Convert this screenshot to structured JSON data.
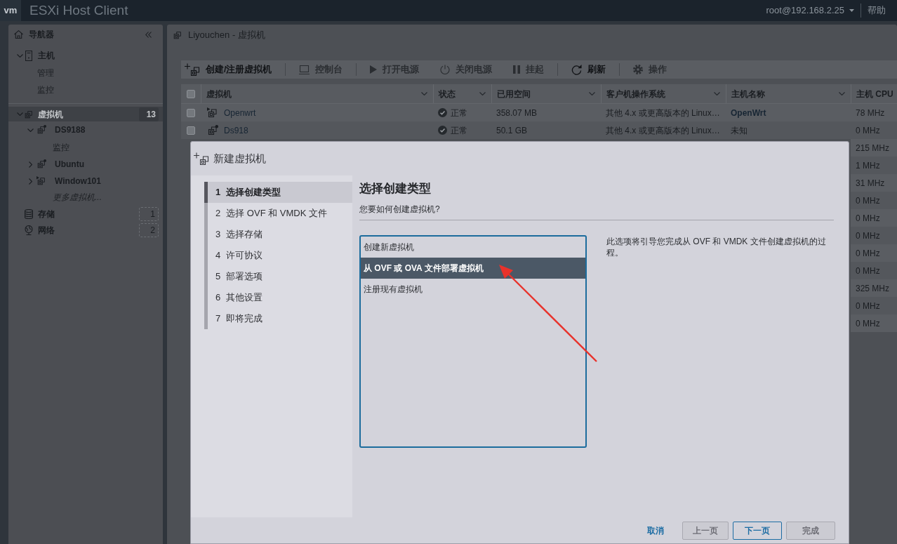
{
  "header": {
    "logo": "vm",
    "title": "ESXi Host Client",
    "user": "root@192.168.2.25",
    "help": "帮助"
  },
  "navigator": {
    "title": "导航器",
    "items": [
      {
        "kind": "host",
        "label": "主机",
        "expanded": true,
        "selected": false,
        "children": [
          {
            "label": "管理",
            "selected": false
          },
          {
            "label": "监控",
            "selected": false
          }
        ]
      },
      {
        "kind": "vms",
        "label": "虚拟机",
        "expanded": true,
        "selected": true,
        "count": "13",
        "children": [
          {
            "kind": "vm",
            "label": "DS9188",
            "running": false,
            "expanded": true,
            "selected": false,
            "children": [
              {
                "label": "监控",
                "selected": false
              }
            ]
          },
          {
            "kind": "vm",
            "label": "Ubuntu",
            "running": false,
            "expanded": false,
            "selected": false
          },
          {
            "kind": "vm",
            "label": "Window101",
            "running": true,
            "expanded": false,
            "selected": false
          },
          {
            "kind": "more",
            "label": "更多虚拟机...",
            "selected": false
          }
        ]
      },
      {
        "kind": "storage",
        "label": "存储",
        "selected": false,
        "count": "1"
      },
      {
        "kind": "network",
        "label": "网络",
        "selected": false,
        "count": "2"
      }
    ]
  },
  "main": {
    "title": "Liyouchen - 虚拟机",
    "toolbar": [
      {
        "items": [
          {
            "kind": "create",
            "label": "创建/注册虚拟机",
            "disabled": false
          }
        ]
      },
      {
        "items": [
          {
            "kind": "console",
            "label": "控制台",
            "disabled": true
          }
        ]
      },
      {
        "items": [
          {
            "kind": "power-on",
            "label": "打开电源",
            "disabled": true
          },
          {
            "kind": "power-off",
            "label": "关闭电源",
            "disabled": true
          },
          {
            "kind": "suspend",
            "label": "挂起",
            "disabled": true
          }
        ]
      },
      {
        "items": [
          {
            "kind": "refresh",
            "label": "刷新",
            "disabled": false
          }
        ]
      },
      {
        "items": [
          {
            "kind": "actions",
            "label": "操作",
            "disabled": true
          }
        ]
      }
    ],
    "table": {
      "select_all_checked": false,
      "columns": [
        "虚拟机",
        "状态",
        "已用空间",
        "客户机操作系统",
        "主机名称",
        "主机 CPU"
      ],
      "rows": [
        {
          "checked": false,
          "vm": "Openwrt",
          "running": true,
          "status": "正常",
          "used_space": "358.07 MB",
          "guest_os": "其他 4.x 或更高版本的 Linux…",
          "host_name": "OpenWrt",
          "host_name_linked": true,
          "host_cpu": "78 MHz"
        },
        {
          "checked": false,
          "vm": "Ds918",
          "running": false,
          "status": "正常",
          "used_space": "50.1 GB",
          "guest_os": "其他 4.x 或更高版本的 Linux…",
          "host_name": "未知",
          "host_name_linked": false,
          "host_cpu": "0 MHz"
        },
        {
          "host_cpu": "215 MHz"
        },
        {
          "host_cpu": "1 MHz"
        },
        {
          "host_cpu": "31 MHz"
        },
        {
          "host_cpu": "0 MHz"
        },
        {
          "host_cpu": "0 MHz"
        },
        {
          "host_cpu": "0 MHz"
        },
        {
          "host_cpu": "0 MHz"
        },
        {
          "host_cpu": "0 MHz"
        },
        {
          "host_cpu": "325 MHz"
        },
        {
          "host_cpu": "0 MHz"
        },
        {
          "host_cpu": "0 MHz"
        }
      ]
    }
  },
  "dialog": {
    "title": "新建虚拟机",
    "steps": [
      {
        "number": "1",
        "label": "选择创建类型",
        "selected": true
      },
      {
        "number": "2",
        "label": "选择 OVF 和 VMDK 文件",
        "selected": false
      },
      {
        "number": "3",
        "label": "选择存储",
        "selected": false
      },
      {
        "number": "4",
        "label": "许可协议",
        "selected": false
      },
      {
        "number": "5",
        "label": "部署选项",
        "selected": false
      },
      {
        "number": "6",
        "label": "其他设置",
        "selected": false
      },
      {
        "number": "7",
        "label": "即将完成",
        "selected": false
      }
    ],
    "heading": "选择创建类型",
    "subtitle": "您要如何创建虚拟机?",
    "options": [
      {
        "label": "创建新虚拟机",
        "selected": false
      },
      {
        "label": "从 OVF 或 OVA 文件部署虚拟机",
        "selected": true
      },
      {
        "label": "注册现有虚拟机",
        "selected": false
      }
    ],
    "description": "此选项将引导您完成从 OVF 和 VMDK 文件创建虚拟机的过程。",
    "buttons": [
      {
        "kind": "link",
        "label": "取消",
        "disabled": false
      },
      {
        "kind": "secondary",
        "label": "上一页",
        "disabled": true
      },
      {
        "kind": "primary",
        "label": "下一页",
        "disabled": false
      },
      {
        "kind": "primary",
        "label": "完成",
        "disabled": true
      }
    ]
  }
}
